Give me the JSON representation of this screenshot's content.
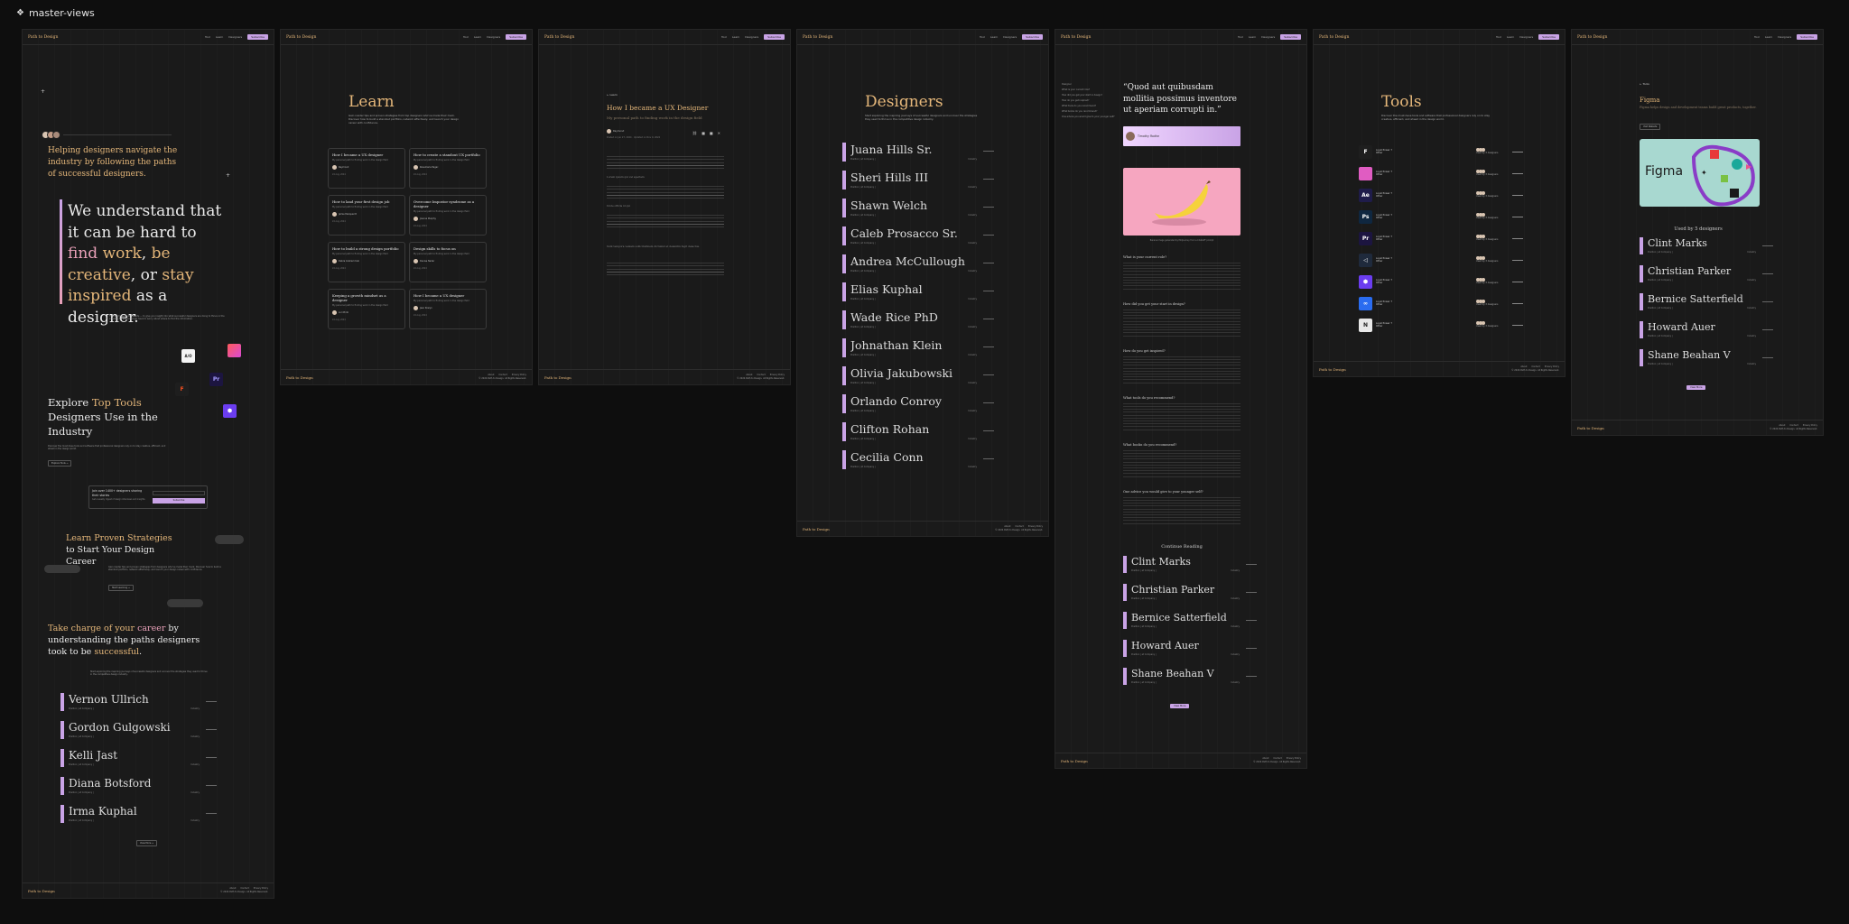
{
  "canvas": {
    "title": "master-views"
  },
  "nav": {
    "logo": "Path to Design",
    "links": [
      "Tool",
      "Learn",
      "Designers"
    ],
    "cta": "Subscribe"
  },
  "footer": {
    "logo": "Path to Design",
    "links": [
      "About",
      "Contact",
      "Privacy Policy"
    ],
    "copyright": "© 2024 Path to Design. All Rights Reserved."
  },
  "home": {
    "hero_heading": "Helping designers navigate the industry by following the paths of successful designers.",
    "quote": {
      "p1": "We understand that it can be hard to ",
      "find": "find",
      "p2": " ",
      "work": "work",
      "p3": ", ",
      "creative": "be creative",
      "p4": ", or ",
      "inspired": "stay inspired",
      "p5": " as a designer."
    },
    "quote_body": "That's why we built this site — to give you insight into what successful designers are doing to thrive in the industry, so you no longer have to worry about where to find the information.",
    "tools_heading_pre": "Explore ",
    "tools_heading_hl": "Top Tools",
    "tools_heading_post": " Designers Use in the Industry",
    "tools_body": "Discover the must-have tools and software that professional designers rely on to stay creative, efficient, and ahead in the design world.",
    "tools_btn": "Explore Tools →",
    "newsletter_title": "Join over 1400+ designers sharing their stories",
    "newsletter_sub": "Get a weekly digest of design interviews and insights.",
    "newsletter_btn": "Subscribe",
    "strategies_hl": "Learn Proven Strategies",
    "strategies_rest": " to Start Your Design Career",
    "strategies_body": "Gain insider tips and proven strategies from designers who've made their mark. Discover how to build a standout portfolio, network effectively, and launch your design career with confidence.",
    "strategies_btn": "Start Learning →",
    "career_pre": "Take charge of your ",
    "career_hl": "career",
    "career_mid": " by understanding the paths designers took to be ",
    "career_hl2": "successful",
    "career_end": ".",
    "career_body": "Start exploring the inspiring journeys of successful designers and uncover the strategies they used to thrive in the competitive design industry.",
    "designers": [
      "Vernon Ullrich",
      "Gordon Gulgowski",
      "Kelli Jast",
      "Diana Botsford",
      "Irma Kuphal"
    ],
    "more_btn": "View More →"
  },
  "learn": {
    "title": "Learn",
    "subtitle": "Gain insider tips and proven strategies from top designers who've made their mark. Discover how to build a standout portfolio, network effectively, and launch your design career with confidence.",
    "cards": [
      {
        "title": "How I became a UX designer",
        "author": "Raymond"
      },
      {
        "title": "How to create a standout UX portfolio",
        "author": "Rosemarie Pagac"
      },
      {
        "title": "How to land your first design job",
        "author": "Jamie Marquardt"
      },
      {
        "title": "Overcome Impostor syndrome as a designer",
        "author": "Joanna Murphy"
      },
      {
        "title": "How to build a strong design portfolio",
        "author": "Debra Graham Kub"
      },
      {
        "title": "Design skills to focus on",
        "author": "Denise Nader"
      },
      {
        "title": "Keeping a growth mindset as a designer",
        "author": "Lori Pinto"
      },
      {
        "title": "How I became a UX designer",
        "author": "Jean Roslyn"
      }
    ],
    "card_desc": "My personal path to finding work in the design field",
    "card_date": "24 Aug, 2024"
  },
  "article": {
    "back": "← Learn",
    "title": "How I became a UX Designer",
    "subtitle": "My personal path to finding work in the design field",
    "author": "Raymond",
    "meta": "Posted on Jan 27, 2024 · Updated on Nov 9, 2024",
    "headings": [
      "Lorem ipsum qui vel aperiam",
      "Unde officia id qui",
      "Sunt tempora veniam sollicitudinem dictumst et delenitm fugit delectus."
    ]
  },
  "designers_page": {
    "title": "Designers",
    "subtitle": "Start exploring the inspiring journeys of successful designers and uncover the strategies they used to thrive in the competitive design industry.",
    "names": [
      "Juana Hills Sr.",
      "Sheri Hills III",
      "Shawn Welch",
      "Caleb Prosacco Sr.",
      "Andrea McCullough",
      "Elias Kuphal",
      "Wade Rice PhD",
      "Johnathan Klein",
      "Olivia Jakubowski",
      "Orlando Conroy",
      "Clifton Rohan",
      "Cecilia Conn"
    ],
    "meta": "Position | at Company |",
    "tag": "Industry"
  },
  "interview": {
    "quote": "“Quod aut quibusdam mollitia possimus inventore ut aperiam corrupti in.”",
    "person": "Timothy Rodhe",
    "toc": [
      "Designer",
      "What is your current role?",
      "How did you get your start in design?",
      "How do you get inspired?",
      "What tools do you recommend?",
      "What books do you recommend?",
      "One advice you would give to your younger self?"
    ],
    "questions": [
      "What is your current role?",
      "How did you get your start in design?",
      "How do you get inspired?",
      "What tools do you recommend?",
      "What books do you recommend?",
      "One advice you would give to your younger self?"
    ],
    "image_caption": "Banana image generated by Midjourney from a ChatGPT prompt",
    "continue": "Continue Reading",
    "more": [
      "Clint Marks",
      "Christian Parker",
      "Bernice Satterfield",
      "Howard Auer",
      "Shane Beahan V"
    ],
    "more_btn": "View More"
  },
  "tools": {
    "title": "Tools",
    "subtitle": "Discover the must-have tools and software that professional designers rely on to stay creative, efficient, and ahead in the design world.",
    "tool_name": "Loyal Power 7",
    "tool_type": "Other",
    "tool_users": "Used by 3 designers",
    "icons": [
      {
        "label": "F",
        "color": "#1e1e1e",
        "name": "figma-icon"
      },
      {
        "label": "",
        "color": "#e05cc2",
        "name": "creative-cloud-icon"
      },
      {
        "label": "Ae",
        "color": "#1f1c4a",
        "name": "after-effects-icon"
      },
      {
        "label": "Ps",
        "color": "#0f2740",
        "name": "photoshop-icon"
      },
      {
        "label": "Pr",
        "color": "#1c1540",
        "name": "premiere-icon"
      },
      {
        "label": "◁",
        "color": "#1f2a3c",
        "name": "vscode-icon"
      },
      {
        "label": "⬢",
        "color": "#6b3df0",
        "name": "framer-icon"
      },
      {
        "label": "∞",
        "color": "#2a6cf0",
        "name": "meta-icon"
      },
      {
        "label": "N",
        "color": "#e8e8e8",
        "name": "notion-icon"
      }
    ]
  },
  "tool_detail": {
    "back": "← Tools",
    "name": "Figma",
    "desc": "Figma helps design and development teams build great products, together.",
    "btn": "Visit Website",
    "hero_label": "Figma",
    "used_by": "Used by 5 designers",
    "names": [
      "Clint Marks",
      "Christian Parker",
      "Bernice Satterfield",
      "Howard Auer",
      "Shane Beahan V"
    ],
    "more_btn": "View More"
  }
}
